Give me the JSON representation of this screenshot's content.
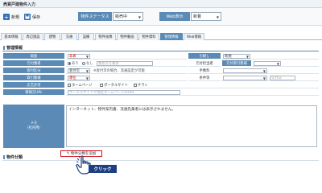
{
  "window": {
    "title": "売買戸建物件入力"
  },
  "toolbar": {
    "new_label": "新規",
    "save_label": "保存",
    "status_label": "物件ステータス",
    "status_value": "販売中",
    "web_label": "Web表示",
    "web_value": "新着",
    "colors": {
      "accent": "#5a8ab5",
      "new_icon": "#2f6db5",
      "save_icon": "#2f6db5"
    }
  },
  "tabs": [
    {
      "label": "基本情報"
    },
    {
      "label": "周辺施設"
    },
    {
      "label": "建物"
    },
    {
      "label": "交通"
    },
    {
      "label": "設備"
    },
    {
      "label": "物件画像"
    },
    {
      "label": "物件動画"
    },
    {
      "label": "物件資料"
    },
    {
      "label": "管理情報"
    },
    {
      "label": "Web情報"
    }
  ],
  "section": {
    "title": "管理情報"
  },
  "rows": {
    "r1": {
      "label_a": "取扱",
      "value_a": "非表",
      "label_b": "引継し",
      "value_b": "新規"
    },
    "r2": {
      "label_a": "元付業者",
      "radio1": "あり",
      "radio2": "なし",
      "placeholder": "業者名を検索",
      "label_b": "元付担当者",
      "label_c": "元付取引態様"
    },
    "r3": {
      "label_a": "客付区分",
      "value_a": "客付可",
      "note": "※客付可の場合、流通設定が可能",
      "label_b": "手数料"
    },
    "r4": {
      "label_a": "取引態様",
      "value_a": "専任",
      "label_b": "条件等",
      "suffix": "年月日"
    },
    "r5": {
      "label_a": "広告許可",
      "check1": "ホームページ",
      "check2": "ポータルサイト",
      "check3": "チラシ"
    },
    "r6": {
      "label_a": "情報元URL",
      "placeholder": "ポータルサイトや他社ホームページのURL"
    }
  },
  "memo": {
    "label_line1": "メモ",
    "label_line2": "（社内用）",
    "text": "インターネット、物件案内書、流通先業者には表示されません。"
  },
  "bottom": {
    "section_title": "物件分類",
    "add_button": "物件分類を追加",
    "click_label": "クリック"
  },
  "icons": {
    "new": "plus-icon",
    "save": "floppy-disk-icon",
    "pencil": "edit-icon",
    "hand": "pointer-hand-icon"
  }
}
